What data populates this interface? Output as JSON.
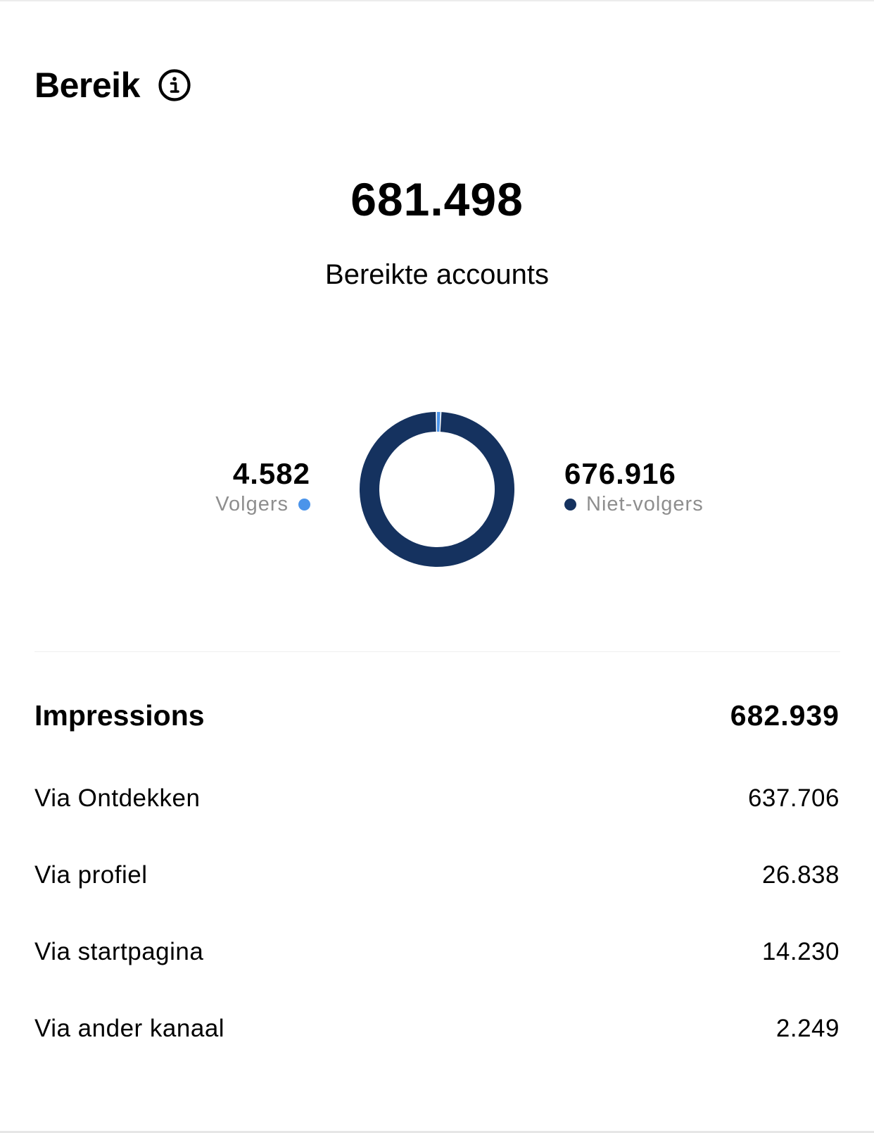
{
  "reach": {
    "title": "Bereik",
    "info_icon": "info-icon",
    "total_value": "681.498",
    "total_label": "Bereikte accounts"
  },
  "audience": {
    "followers": {
      "value": "4.582",
      "label": "Volgers",
      "color": "#4b94ea",
      "count": 4582
    },
    "non_followers": {
      "value": "676.916",
      "label": "Niet-volgers",
      "color": "#15325f",
      "count": 676916
    }
  },
  "impressions": {
    "label": "Impressions",
    "value": "682.939",
    "rows": [
      {
        "label": "Via Ontdekken",
        "value": "637.706"
      },
      {
        "label": "Via profiel",
        "value": "26.838"
      },
      {
        "label": "Via startpagina",
        "value": "14.230"
      },
      {
        "label": "Via ander kanaal",
        "value": "2.249"
      }
    ]
  },
  "colors": {
    "accent_dark": "#15325f",
    "accent_light": "#4b94ea",
    "muted_text": "#8e8e8e"
  }
}
